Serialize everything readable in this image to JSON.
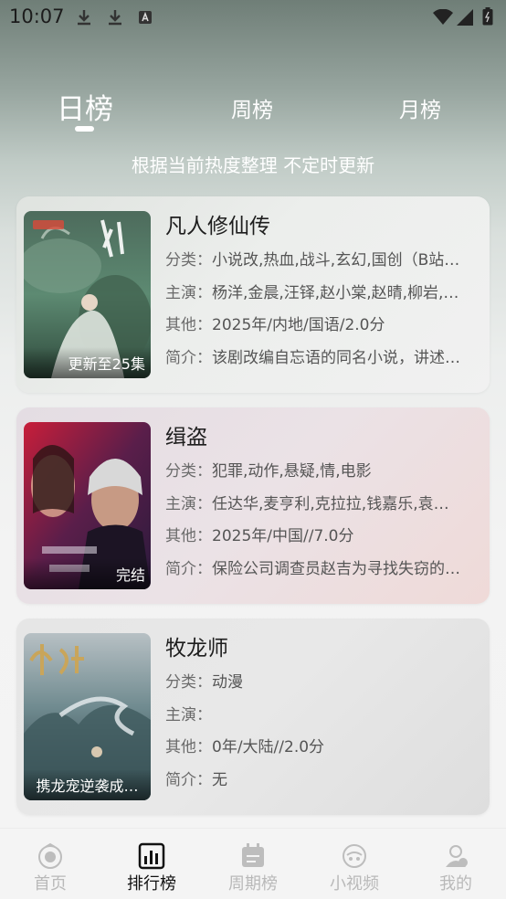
{
  "status_bar": {
    "time": "10:07",
    "icons": [
      "download-icon",
      "download-icon",
      "a-icon",
      "wifi-icon",
      "cell-signal-icon",
      "battery-icon"
    ]
  },
  "tabs": [
    {
      "label": "日榜",
      "active": true
    },
    {
      "label": "周榜",
      "active": false
    },
    {
      "label": "月榜",
      "active": false
    }
  ],
  "subtitle": "根据当前热度整理 不定时更新",
  "labels": {
    "category": "分类：",
    "cast": "主演：",
    "other": "其他：",
    "intro": "简介："
  },
  "items": [
    {
      "title": "凡人修仙传",
      "badge": "更新至25集",
      "category": "小说改,热血,战斗,玄幻,国创（B站…",
      "cast": "杨洋,金晨,汪铎,赵小棠,赵晴,柳岩,…",
      "other": "2025年/内地/国语/2.0分",
      "intro": "该剧改编自忘语的同名小说，讲述…"
    },
    {
      "title": "缉盗",
      "badge": "完结",
      "category": "犯罪,动作,悬疑,情,电影",
      "cast": "任达华,麦亨利,克拉拉,钱嘉乐,袁…",
      "other": "2025年/中国//7.0分",
      "intro": "保险公司调查员赵吉为寻找失窃的…"
    },
    {
      "title": "牧龙师",
      "badge": "携龙宠逆袭成…",
      "category": "动漫",
      "cast": "",
      "other": "0年/大陆//2.0分",
      "intro": "无"
    }
  ],
  "bottom_nav": [
    {
      "label": "首页",
      "icon": "home-icon",
      "active": false
    },
    {
      "label": "排行榜",
      "icon": "ranking-icon",
      "active": true
    },
    {
      "label": "周期榜",
      "icon": "calendar-icon",
      "active": false
    },
    {
      "label": "小视频",
      "icon": "short-video-icon",
      "active": false
    },
    {
      "label": "我的",
      "icon": "profile-icon",
      "active": false
    }
  ],
  "colors": {
    "active_text": "#111111",
    "inactive_text": "#b9b9b9",
    "tab_text": "#ffffff"
  }
}
